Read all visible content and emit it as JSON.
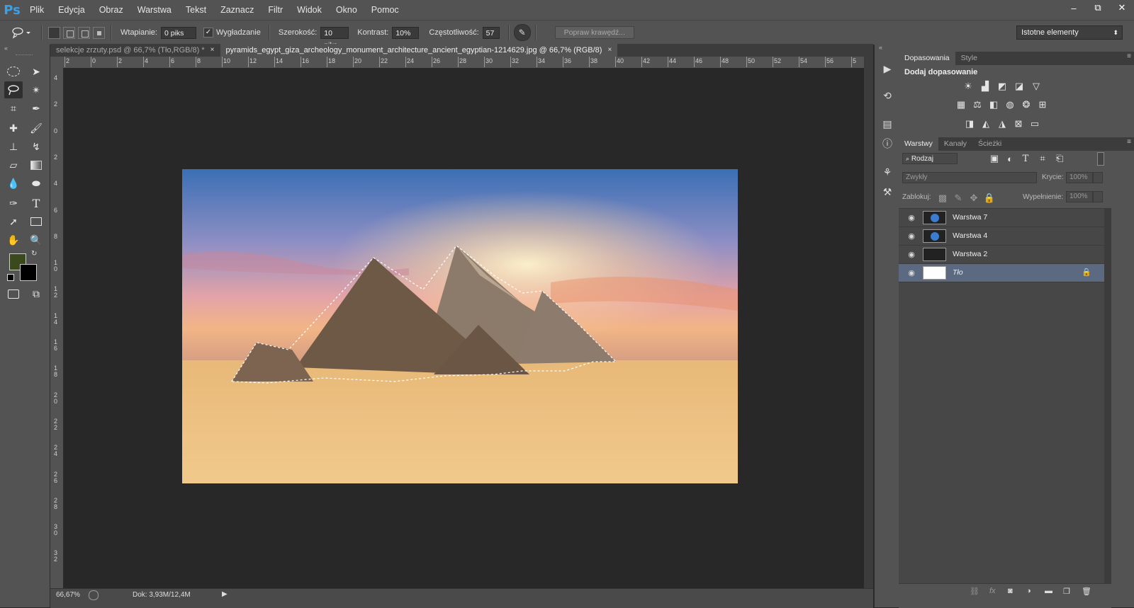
{
  "app": {
    "logo": "Ps"
  },
  "menu": [
    "Plik",
    "Edycja",
    "Obraz",
    "Warstwa",
    "Tekst",
    "Zaznacz",
    "Filtr",
    "Widok",
    "Okno",
    "Pomoc"
  ],
  "window_controls": {
    "minimize": "–",
    "restore": "⧉",
    "close": "✕"
  },
  "options": {
    "feather_label": "Wtapianie:",
    "feather_value": "0 piks",
    "antialias_label": "Wygładzanie",
    "antialias_checked": true,
    "width_label": "Szerokość:",
    "width_value": "10 piks",
    "contrast_label": "Kontrast:",
    "contrast_value": "10%",
    "frequency_label": "Częstotliwość:",
    "frequency_value": "57",
    "refine_edge": "Popraw krawędź...",
    "workspace": "Istotne elementy"
  },
  "tabs": [
    {
      "label": "selekcje zrzuty.psd @ 66,7% (Tło,RGB/8) *",
      "close": "×",
      "active": false
    },
    {
      "label": "pyramids_egypt_giza_archeology_monument_architecture_ancient_egyptian-1214629.jpg @ 66,7% (RGB/8)",
      "close": "×",
      "active": true
    }
  ],
  "hruler_labels": [
    "2",
    "0",
    "2",
    "4",
    "6",
    "8",
    "10",
    "12",
    "14",
    "16",
    "18",
    "20",
    "22",
    "24",
    "26",
    "28",
    "30",
    "32",
    "34",
    "36",
    "38",
    "40",
    "42",
    "44",
    "46",
    "48",
    "50",
    "52",
    "54",
    "56",
    "5"
  ],
  "vruler_labels": [
    "4",
    "2",
    "0",
    "2",
    "4",
    "6",
    "8",
    "1\n0",
    "1\n2",
    "1\n4",
    "1\n6",
    "1\n8",
    "2\n0",
    "2\n2",
    "2\n4",
    "2\n6",
    "2\n8",
    "3\n0",
    "3\n2"
  ],
  "status": {
    "zoom": "66,67%",
    "doc": "Dok: 3,93M/12,4M"
  },
  "colors": {
    "foreground": "#3a4a1c",
    "background": "#000000",
    "selection_highlight": "#5b6a80"
  },
  "adjustments": {
    "tab_active": "Dopasowania",
    "tab_other": "Style",
    "heading": "Dodaj dopasowanie",
    "icons": [
      "brightness-icon",
      "levels-icon",
      "curves-icon",
      "exposure-icon",
      "vibrance-icon",
      "hue-saturation-icon",
      "color-balance-icon",
      "black-white-icon",
      "photo-filter-icon",
      "channel-mixer-icon",
      "color-lookup-icon",
      "invert-icon",
      "posterize-icon",
      "threshold-icon",
      "selective-color-icon",
      "gradient-map-icon"
    ]
  },
  "layers_panel": {
    "tabs": [
      "Warstwy",
      "Kanały",
      "Ścieżki"
    ],
    "filter_kind": "Rodzaj",
    "blend_mode": "Zwykły",
    "opacity_label": "Krycie:",
    "opacity_value": "100%",
    "lock_label": "Zablokuj:",
    "fill_label": "Wypełnienie:",
    "fill_value": "100%",
    "layers": [
      {
        "name": "Warstwa 7",
        "selected": false,
        "locked": false
      },
      {
        "name": "Warstwa 4",
        "selected": false,
        "locked": false
      },
      {
        "name": "Warstwa 2",
        "selected": false,
        "locked": false
      },
      {
        "name": "Tło",
        "selected": true,
        "locked": true
      }
    ]
  }
}
